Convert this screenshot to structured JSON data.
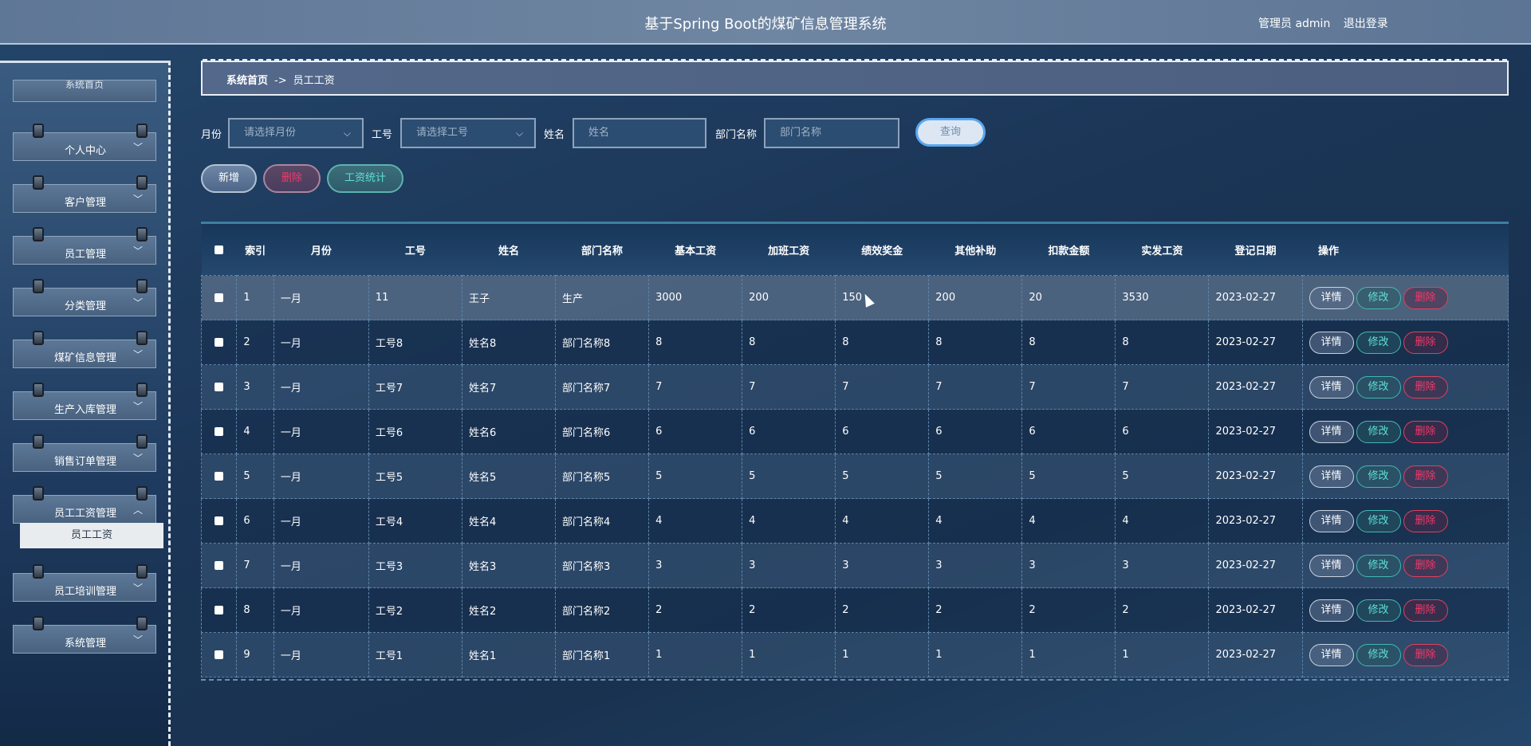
{
  "header": {
    "title": "基于Spring Boot的煤矿信息管理系统",
    "user": "管理员 admin",
    "logout": "退出登录"
  },
  "sidebar": {
    "top_partial": "系统首页",
    "items": [
      {
        "label": "个人中心"
      },
      {
        "label": "客户管理"
      },
      {
        "label": "员工管理"
      },
      {
        "label": "分类管理"
      },
      {
        "label": "煤矿信息管理"
      },
      {
        "label": "生产入库管理"
      },
      {
        "label": "销售订单管理"
      },
      {
        "label": "员工工资管理"
      },
      {
        "label": "员工培训管理"
      },
      {
        "label": "系统管理"
      }
    ],
    "active_sub": "员工工资",
    "chevron_down": "﹀",
    "chevron_up": "︿"
  },
  "breadcrumb": {
    "home": "系统首页",
    "sep": "->",
    "current": "员工工资"
  },
  "search": {
    "month_label": "月份",
    "month_placeholder": "请选择月份",
    "job_label": "工号",
    "job_placeholder": "请选择工号",
    "name_label": "姓名",
    "name_placeholder": "姓名",
    "dept_label": "部门名称",
    "dept_placeholder": "部门名称",
    "query": "查询"
  },
  "actions": {
    "add": "新增",
    "delete": "删除",
    "stats": "工资统计"
  },
  "table": {
    "headers": [
      "索引",
      "月份",
      "工号",
      "姓名",
      "部门名称",
      "基本工资",
      "加班工资",
      "绩效奖金",
      "其他补助",
      "扣款金额",
      "实发工资",
      "登记日期",
      "操作"
    ],
    "rows": [
      [
        "1",
        "一月",
        "11",
        "王子",
        "生产",
        "3000",
        "200",
        "150",
        "200",
        "20",
        "3530",
        "2023-02-27"
      ],
      [
        "2",
        "一月",
        "工号8",
        "姓名8",
        "部门名称8",
        "8",
        "8",
        "8",
        "8",
        "8",
        "8",
        "2023-02-27"
      ],
      [
        "3",
        "一月",
        "工号7",
        "姓名7",
        "部门名称7",
        "7",
        "7",
        "7",
        "7",
        "7",
        "7",
        "2023-02-27"
      ],
      [
        "4",
        "一月",
        "工号6",
        "姓名6",
        "部门名称6",
        "6",
        "6",
        "6",
        "6",
        "6",
        "6",
        "2023-02-27"
      ],
      [
        "5",
        "一月",
        "工号5",
        "姓名5",
        "部门名称5",
        "5",
        "5",
        "5",
        "5",
        "5",
        "5",
        "2023-02-27"
      ],
      [
        "6",
        "一月",
        "工号4",
        "姓名4",
        "部门名称4",
        "4",
        "4",
        "4",
        "4",
        "4",
        "4",
        "2023-02-27"
      ],
      [
        "7",
        "一月",
        "工号3",
        "姓名3",
        "部门名称3",
        "3",
        "3",
        "3",
        "3",
        "3",
        "3",
        "2023-02-27"
      ],
      [
        "8",
        "一月",
        "工号2",
        "姓名2",
        "部门名称2",
        "2",
        "2",
        "2",
        "2",
        "2",
        "2",
        "2023-02-27"
      ],
      [
        "9",
        "一月",
        "工号1",
        "姓名1",
        "部门名称1",
        "1",
        "1",
        "1",
        "1",
        "1",
        "1",
        "2023-02-27"
      ]
    ],
    "op_detail": "详情",
    "op_edit": "修改",
    "op_delete": "删除"
  }
}
